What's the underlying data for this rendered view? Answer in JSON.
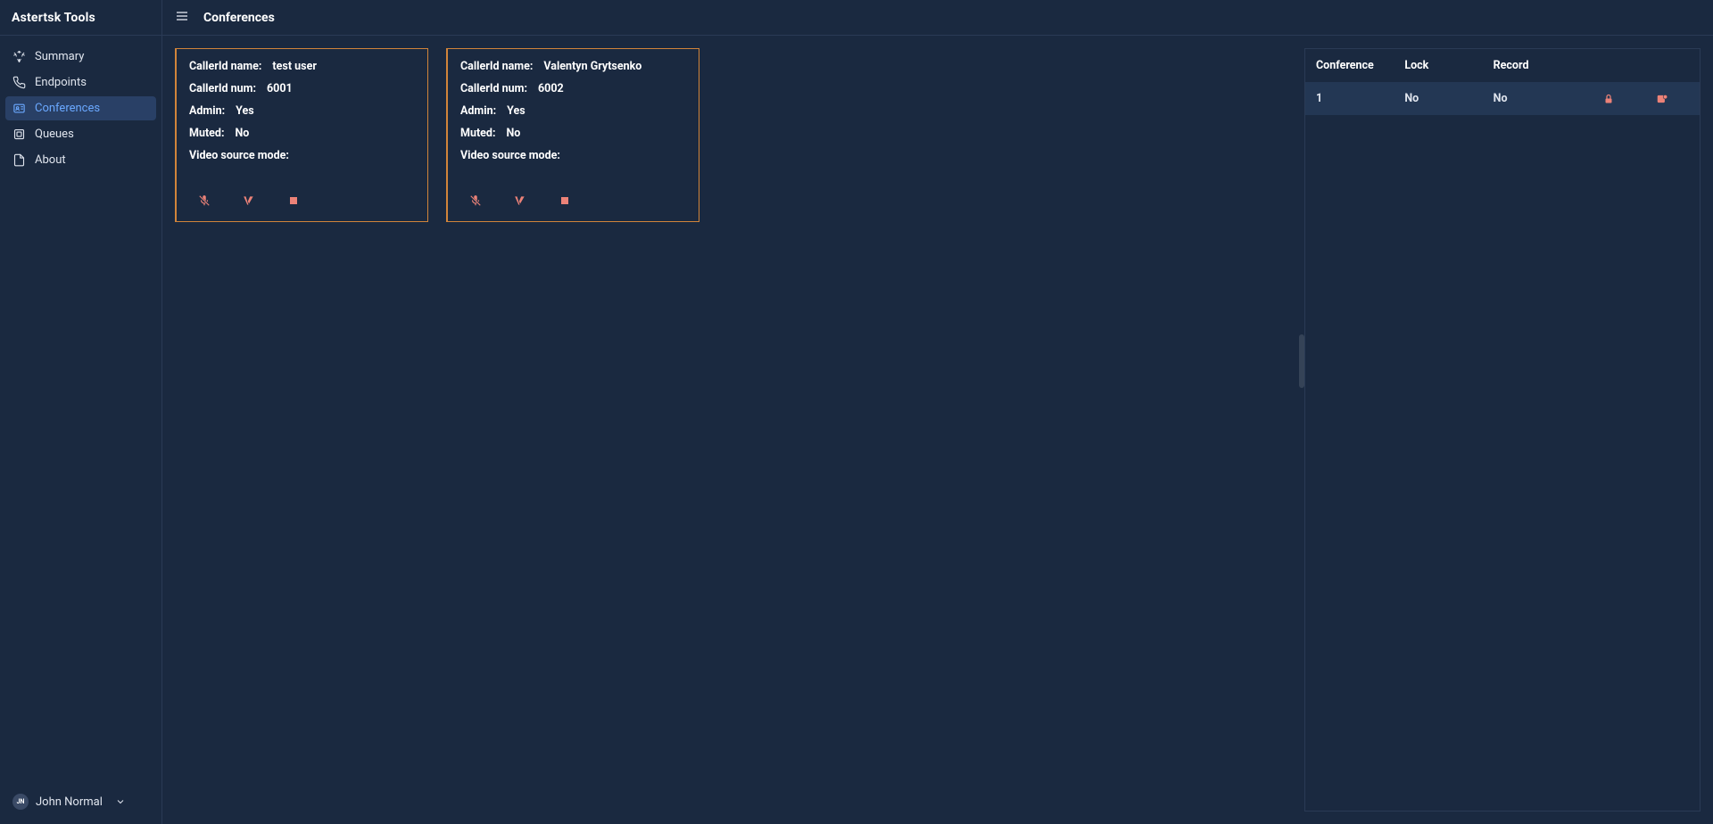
{
  "app_name": "Astertsk Tools",
  "page_title": "Conferences",
  "sidebar": {
    "items": [
      {
        "label": "Summary"
      },
      {
        "label": "Endpoints"
      },
      {
        "label": "Conferences"
      },
      {
        "label": "Queues"
      },
      {
        "label": "About"
      }
    ]
  },
  "user": {
    "initials": "JN",
    "name": "John Normal"
  },
  "participants": {
    "labels": {
      "callerid_name": "CallerId name:",
      "callerid_num": "CallerId num:",
      "admin": "Admin:",
      "muted": "Muted:",
      "video_mode": "Video source mode:"
    },
    "items": [
      {
        "callerid_name": "test user",
        "callerid_num": "6001",
        "admin": "Yes",
        "muted": "No",
        "video_mode": ""
      },
      {
        "callerid_name": "Valentyn Grytsenko",
        "callerid_num": "6002",
        "admin": "Yes",
        "muted": "No",
        "video_mode": ""
      }
    ]
  },
  "conf_table": {
    "headers": {
      "conference": "Conference",
      "lock": "Lock",
      "record": "Record"
    },
    "rows": [
      {
        "conference": "1",
        "lock": "No",
        "record": "No"
      }
    ]
  }
}
